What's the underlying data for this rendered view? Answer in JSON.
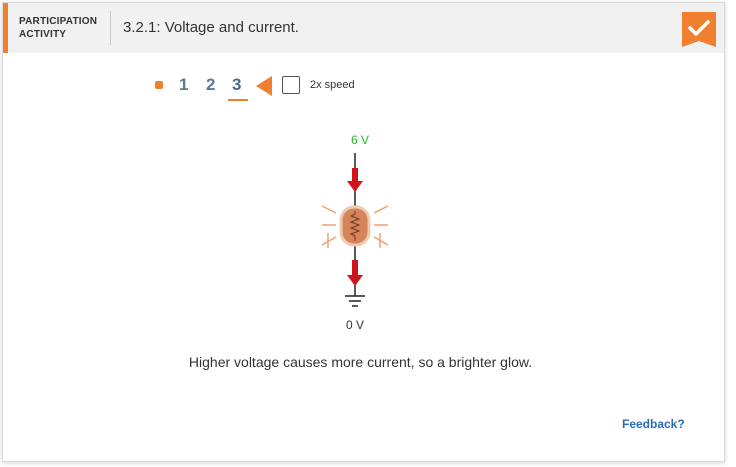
{
  "header": {
    "activity_label_line1": "PARTICIPATION",
    "activity_label_line2": "ACTIVITY",
    "title": "3.2.1: Voltage and current.",
    "accent_color": "#f08030",
    "completion_icon": "check-icon"
  },
  "controls": {
    "steps": [
      "1",
      "2",
      "3"
    ],
    "current_step": "3",
    "speed_label": "2x speed",
    "speed_checked": false
  },
  "circuit": {
    "top_voltage": "6 V",
    "bottom_voltage": "0 V",
    "top_voltage_color": "#22bb22",
    "current_arrow_color": "#d0141e",
    "glow_color": "#f08030",
    "component": "resistor-bulb-icon",
    "ground": "ground-icon"
  },
  "caption": "Higher voltage causes more current, so a brighter glow.",
  "feedback_label": "Feedback?"
}
